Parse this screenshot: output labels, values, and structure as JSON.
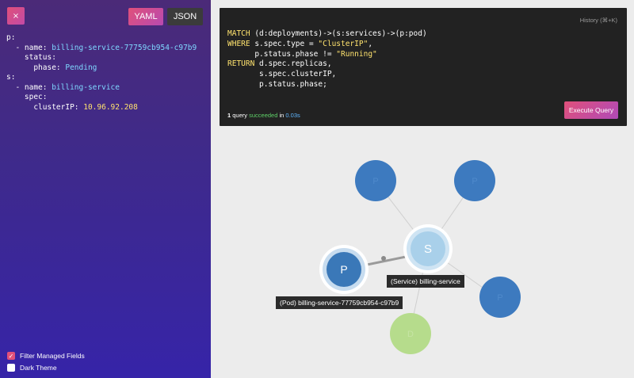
{
  "left_panel": {
    "close_label": "×",
    "yaml_label": "YAML",
    "json_label": "JSON",
    "yaml": {
      "p_key": "p:",
      "p_item_dash": "  - name: ",
      "p_name": "billing-service-77759cb954-c97b9",
      "status_key": "    status:",
      "phase_key": "      phase: ",
      "phase_value": "Pending",
      "s_key": "s:",
      "s_item_dash": "  - name: ",
      "s_name": "billing-service",
      "spec_key": "    spec:",
      "cluster_ip_key": "      clusterIP: ",
      "cluster_ip_value": "10.96.92.208"
    },
    "filter_managed_fields_label": "Filter Managed Fields",
    "filter_managed_fields_checked": true,
    "dark_theme_label": "Dark Theme",
    "dark_theme_checked": false
  },
  "query_panel": {
    "history_label": "History (⌘+K)",
    "query": {
      "line1_kw": "MATCH",
      "line1_rest": " (d:deployments)->(s:services)->(p:pod)",
      "line2_kw": "WHERE",
      "line2_rest": " s.spec.type = ",
      "line2_str": "\"ClusterIP\"",
      "line2_end": ",",
      "line3_rest": "      p.status.phase != ",
      "line3_str": "\"Running\"",
      "line4_kw": "RETURN",
      "line4_rest": " d.spec.replicas,",
      "line5": "       s.spec.clusterIP,",
      "line6": "       p.status.phase;"
    },
    "status_count": "1",
    "status_query_word": " query ",
    "status_succeeded": "succeeded",
    "status_in": " in ",
    "status_time": "0.03s",
    "execute_label": "Execute Query"
  },
  "graph": {
    "nodes": [
      {
        "id": "p1",
        "letter": "P",
        "color": "#3d7abf",
        "faded": true
      },
      {
        "id": "p2",
        "letter": "P",
        "color": "#3d7abf",
        "faded": true
      },
      {
        "id": "s_main",
        "letter": "S",
        "color": "#a9d0ea",
        "faded": false
      },
      {
        "id": "p_main",
        "letter": "P",
        "color": "#3a78b8",
        "faded": false
      },
      {
        "id": "p3",
        "letter": "P",
        "color": "#3d7abf",
        "faded": true
      },
      {
        "id": "d1",
        "letter": "D",
        "color": "#b6dc8c",
        "faded": true
      }
    ],
    "service_label": "(Service) billing-service",
    "pod_label": "(Pod) billing-service-77759cb954-c97b9"
  },
  "colors": {
    "accent_pink": "#e0507a",
    "accent_purple": "#b04ab8",
    "success_green": "#5fd068",
    "time_blue": "#5fb6ff",
    "code_yellow": "#ffe36e"
  }
}
